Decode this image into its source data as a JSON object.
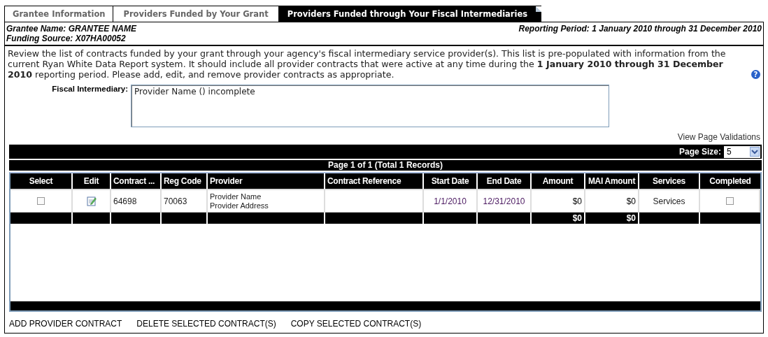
{
  "tabs": [
    {
      "label": "Grantee Information",
      "selected": false
    },
    {
      "label": "Providers Funded by Your Grant",
      "selected": false
    },
    {
      "label": "Providers Funded through Your Fiscal Intermediaries",
      "selected": true
    }
  ],
  "header": {
    "grantee_name": "Grantee Name: GRANTEE NAME",
    "funding_source": "Funding Source: X07HA00052",
    "reporting_period": "Reporting Period: 1 January 2010 through 31 December 2010"
  },
  "intro": "Review the list of contracts funded by your grant through your agency's fiscal intermediary service provider(s). This list is pre-populated with information from the current Ryan White Data Report system. It should include all provider contracts that were active at any time during the **1 January 2010 through 31 December 2010** reporting period. Please add, edit, and remove provider contracts as appropriate.",
  "help": "?",
  "fiscal_intermediary": {
    "label": "Fiscal Intermediary:",
    "value": "Provider Name () incomplete"
  },
  "validations_link": "View Page Validations",
  "grid": {
    "page_size_label": "Page Size:",
    "page_size": "5",
    "pager": "Page 1 of 1 (Total 1 Records)",
    "columns": [
      "Select",
      "Edit",
      "Contract ...",
      "Reg Code",
      "Provider",
      "Contract Reference",
      "Start Date",
      "End Date",
      "Amount",
      "MAI Amount",
      "Services",
      "Completed"
    ],
    "rows": [
      {
        "cells": [
          {
            "kind": "checkbox",
            "checked": false
          },
          {
            "kind": "edit"
          },
          {
            "kind": "text",
            "text": "64698"
          },
          {
            "kind": "text",
            "text": "70063"
          },
          {
            "kind": "lines",
            "lines": [
              "Provider Name",
              "Provider Address"
            ]
          },
          {
            "kind": "empty"
          },
          {
            "kind": "center",
            "text": "1/1/2010"
          },
          {
            "kind": "center",
            "text": "12/31/2010"
          },
          {
            "kind": "money",
            "text": "$0"
          },
          {
            "kind": "money",
            "text": "$0"
          },
          {
            "kind": "center",
            "text": "Services"
          },
          {
            "kind": "checkbox",
            "checked": false
          }
        ]
      }
    ],
    "totals": {
      "amount": "$0",
      "mai_amount": "$0"
    }
  },
  "actions": [
    "ADD PROVIDER CONTRACT",
    "DELETE SELECTED CONTRACT(S)",
    "COPY SELECTED CONTRACT(S)"
  ]
}
